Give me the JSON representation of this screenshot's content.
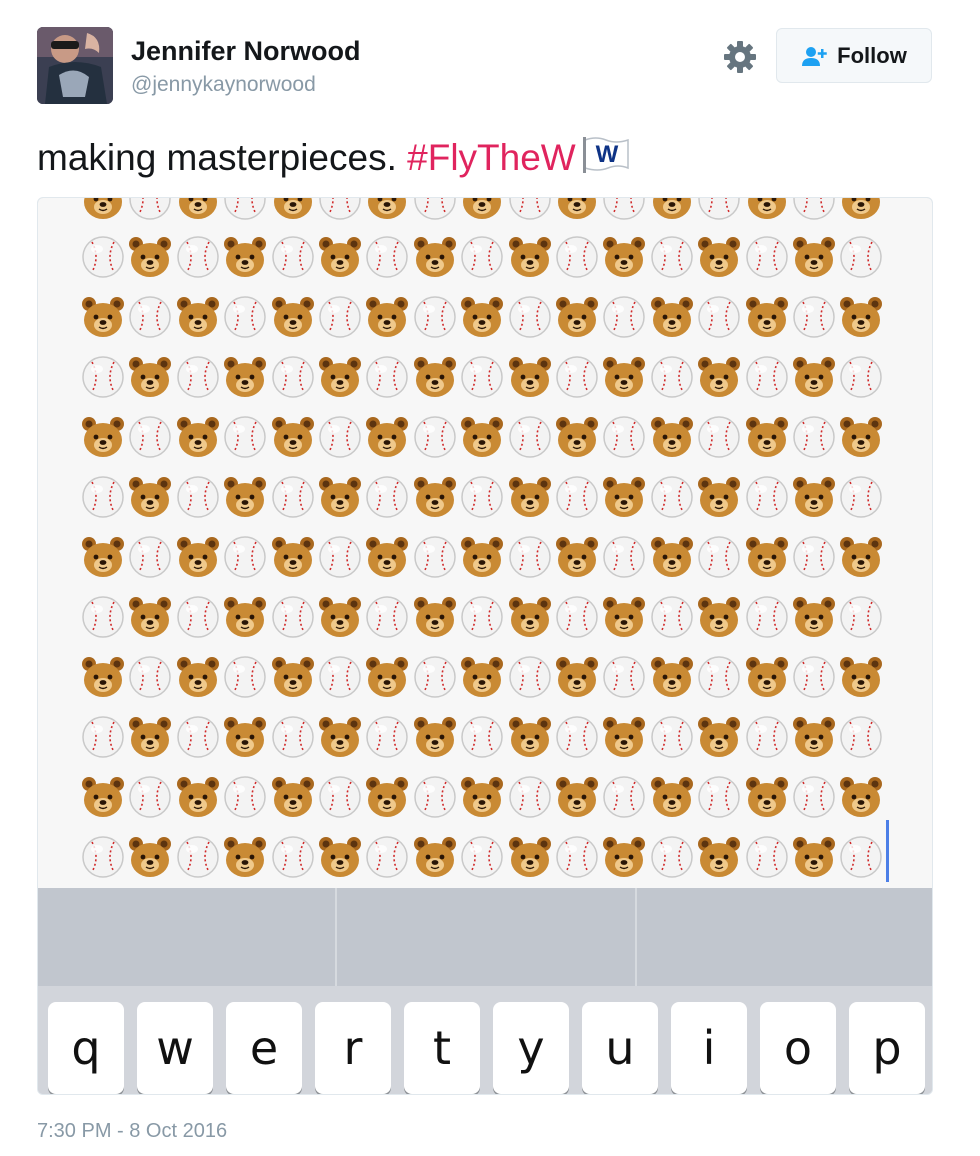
{
  "author": {
    "display_name": "Jennifer Norwood",
    "username": "@jennykaynorwood"
  },
  "actions": {
    "settings_icon": "gear-icon",
    "follow_label": "Follow",
    "follow_icon": "add-user-icon"
  },
  "tweet": {
    "text": "making masterpieces.",
    "hashtag": "#FlyTheW",
    "flag_letter": "W",
    "hashtag_color": "#e0245e"
  },
  "media": {
    "emoji_pattern": [
      "bear-emoji",
      "baseball-emoji"
    ],
    "keyboard": {
      "keys": [
        "q",
        "w",
        "e",
        "r",
        "t",
        "y",
        "u",
        "i",
        "o",
        "p"
      ],
      "suggestion_slots": [
        "",
        "",
        ""
      ]
    }
  },
  "timestamp": "7:30 PM - 8 Oct 2016"
}
